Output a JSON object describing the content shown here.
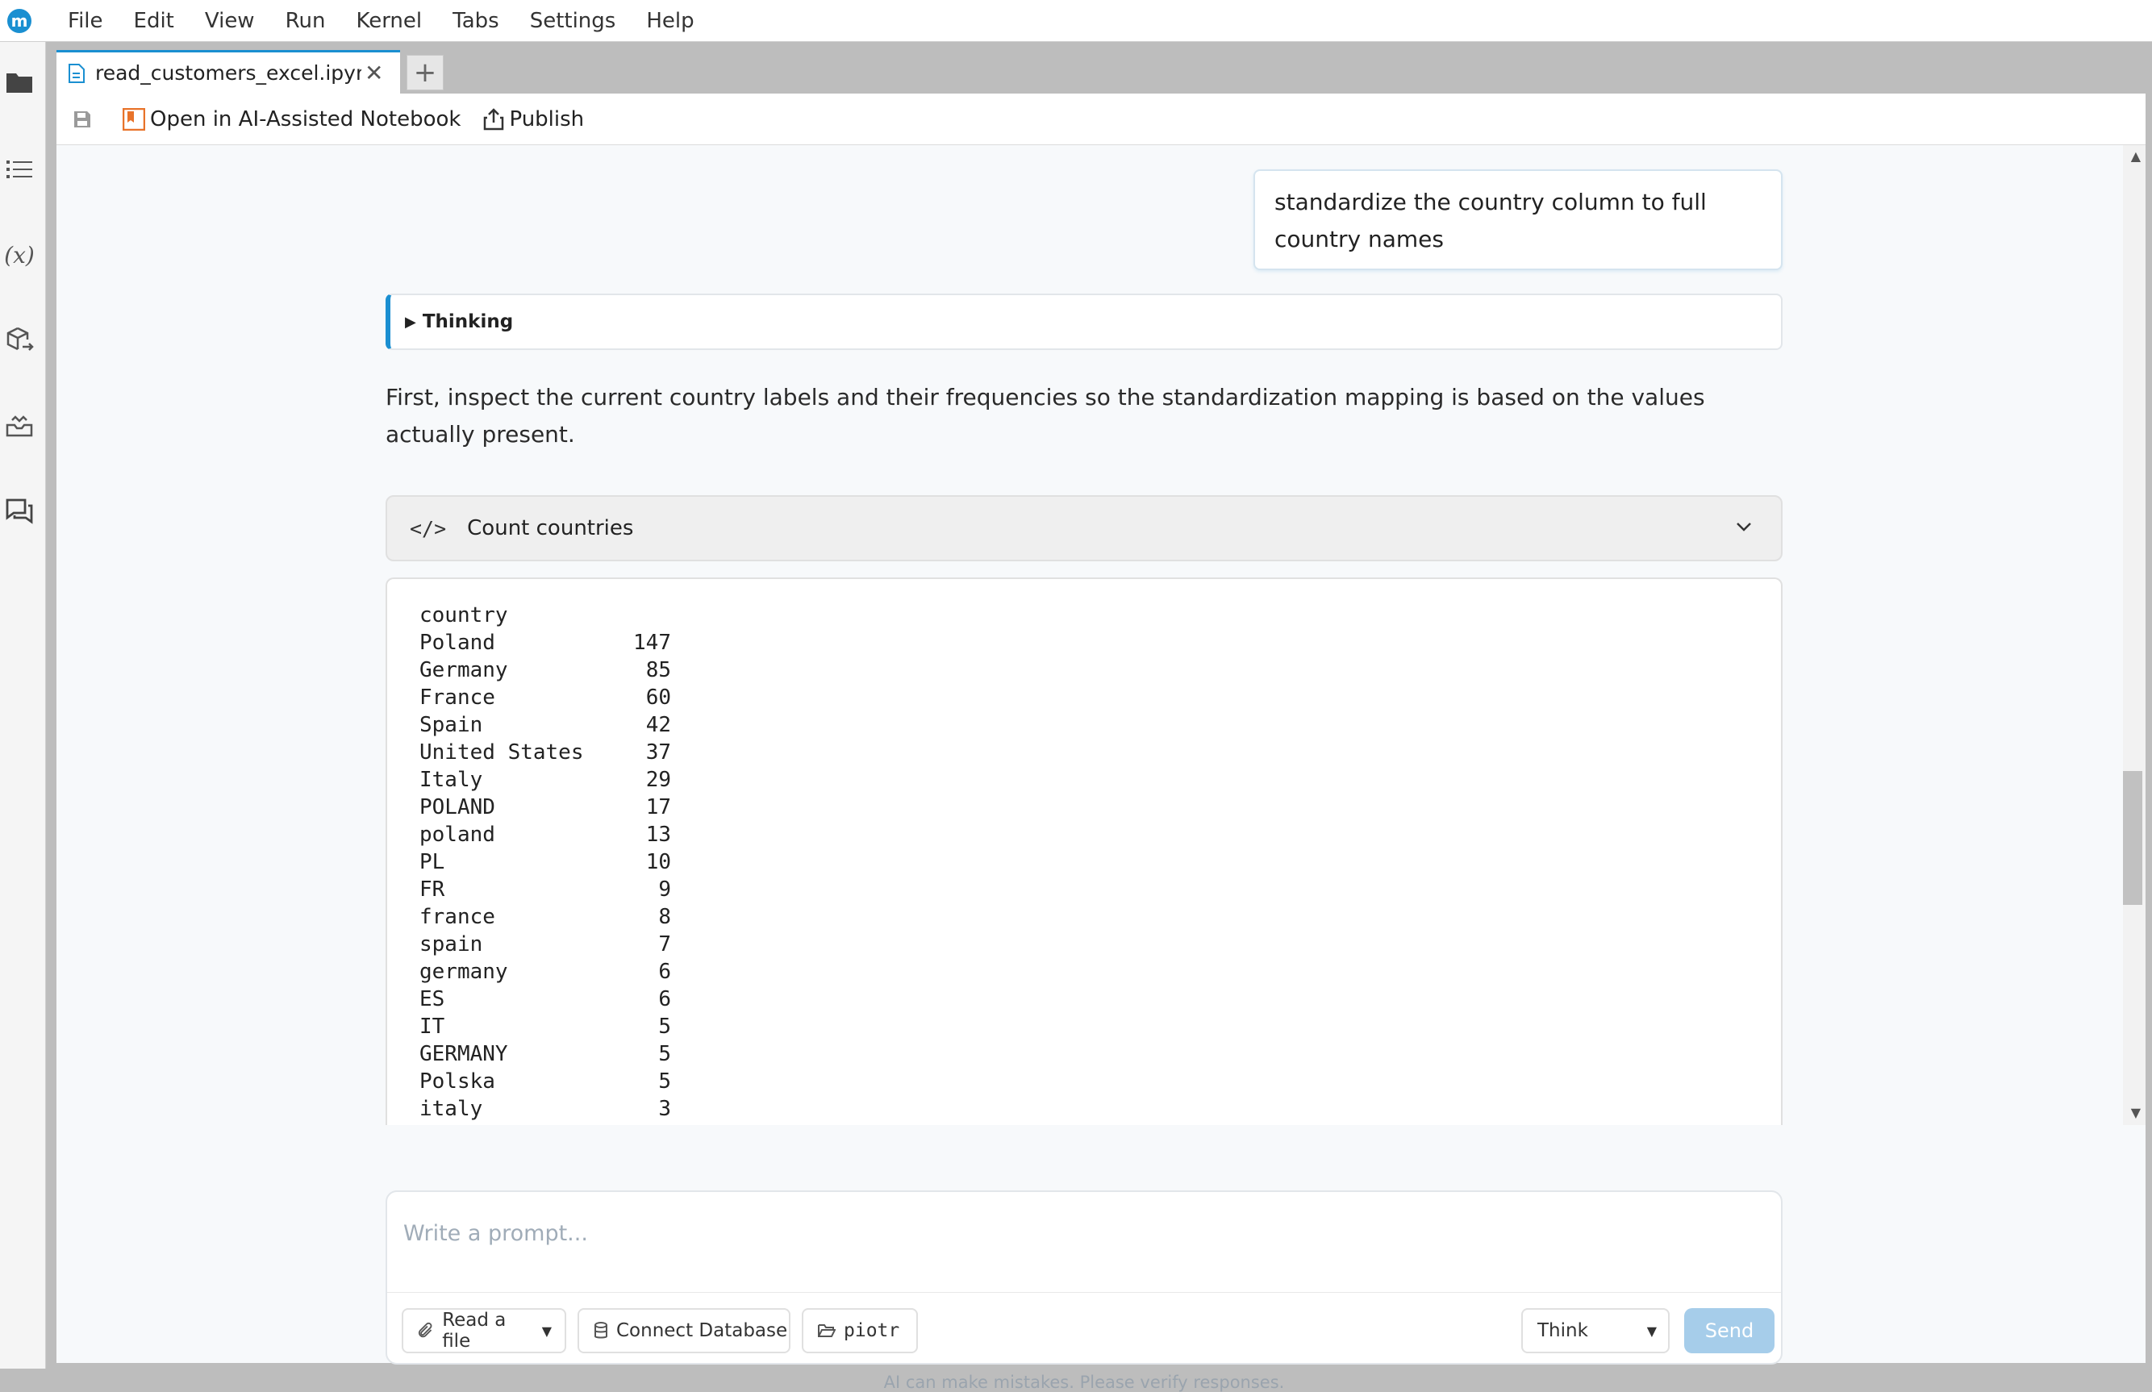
{
  "menubar": {
    "logo": "m",
    "items": [
      "File",
      "Edit",
      "View",
      "Run",
      "Kernel",
      "Tabs",
      "Settings",
      "Help"
    ]
  },
  "sidebar": {
    "icons": [
      "folder-icon",
      "list-icon",
      "variables-icon",
      "package-icon",
      "inbox-icon",
      "chat-icon"
    ],
    "variables_label": "(x)"
  },
  "tabs": {
    "active_title": "read_customers_excel.ipynb",
    "close_glyph": "✕",
    "add_glyph": "+"
  },
  "toolbar": {
    "open_ai_label": "Open in AI-Assisted Notebook",
    "publish_label": "Publish"
  },
  "chat": {
    "user_message": "standardize the country column to full country names",
    "thinking_label": "Thinking",
    "ai_text": "First, inspect the current country labels and their frequencies so the standardization mapping is based on the values actually present.",
    "code_icon": "</>",
    "code_title": "Count countries",
    "output_header": "country",
    "output_rows": [
      {
        "name": "Poland",
        "count": "147"
      },
      {
        "name": "Germany",
        "count": "85"
      },
      {
        "name": "France",
        "count": "60"
      },
      {
        "name": "Spain",
        "count": "42"
      },
      {
        "name": "United States",
        "count": "37"
      },
      {
        "name": "Italy",
        "count": "29"
      },
      {
        "name": "POLAND",
        "count": "17"
      },
      {
        "name": "poland",
        "count": "13"
      },
      {
        "name": "PL",
        "count": "10"
      },
      {
        "name": "FR",
        "count": "9"
      },
      {
        "name": "france",
        "count": "8"
      },
      {
        "name": "spain",
        "count": "7"
      },
      {
        "name": "germany",
        "count": "6"
      },
      {
        "name": "ES",
        "count": "6"
      },
      {
        "name": "IT",
        "count": "5"
      },
      {
        "name": "GERMANY",
        "count": "5"
      },
      {
        "name": "Polska",
        "count": "5"
      },
      {
        "name": "italy",
        "count": "3"
      }
    ]
  },
  "prompt": {
    "placeholder": "Write a prompt...",
    "read_file_label": "Read a file",
    "connect_db_label": "Connect Database",
    "folder_label": "piotr",
    "mode_value": "Think",
    "send_label": "Send",
    "disclaimer": "AI can make mistakes. Please verify responses."
  },
  "colors": {
    "accent": "#1a8fd1",
    "send_disabled": "#a6cdea"
  }
}
